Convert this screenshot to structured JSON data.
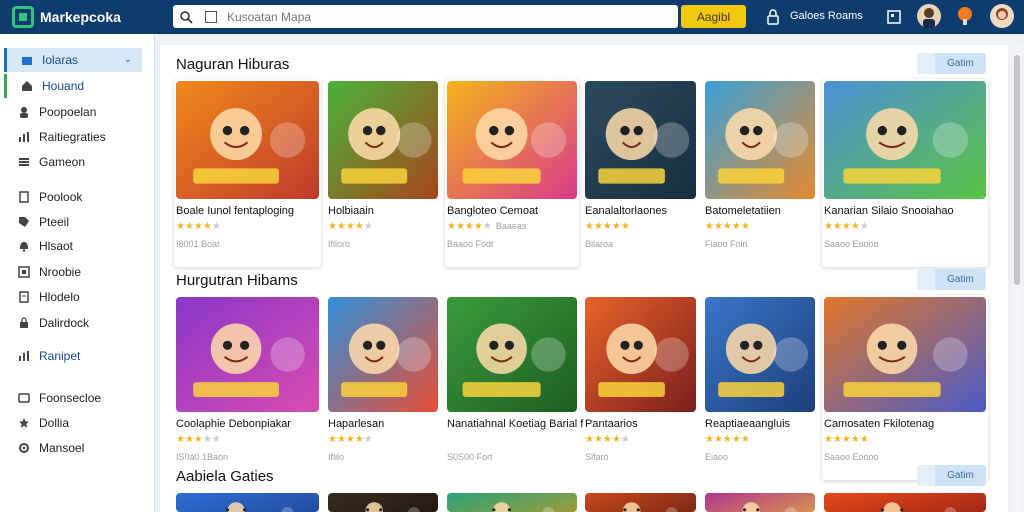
{
  "app": {
    "brand": "Markepcoka"
  },
  "search": {
    "placeholder": "Kusoatan Mapa",
    "button_label": "Aagibl"
  },
  "topbar": {
    "label": "Galoes Roams"
  },
  "sidebar": {
    "items": [
      {
        "label": "Iolaras",
        "icon": "folder-icon"
      },
      {
        "label": "Houand",
        "icon": "home-icon"
      },
      {
        "label": "Poopoelan",
        "icon": "user-icon"
      },
      {
        "label": "Raitiegraties",
        "icon": "chart-icon"
      },
      {
        "label": "Gameon",
        "icon": "list-icon"
      },
      {
        "label": "Poolook",
        "icon": "book-icon"
      },
      {
        "label": "Pteeil",
        "icon": "tag-icon"
      },
      {
        "label": "Hlsaot",
        "icon": "bell-icon"
      },
      {
        "label": "Nroobie",
        "icon": "grid-icon"
      },
      {
        "label": "Hlodelo",
        "icon": "doc-icon"
      },
      {
        "label": "Dalirdock",
        "icon": "lock-icon"
      },
      {
        "label": "Ranipet",
        "icon": "chart-icon"
      },
      {
        "label": "Foonsecloe",
        "icon": "card-icon"
      },
      {
        "label": "Dollia",
        "icon": "star-icon"
      },
      {
        "label": "Mansoel",
        "icon": "gear-icon"
      }
    ]
  },
  "sections": [
    {
      "title": "Naguran Hiburas",
      "see_all": "Gatim",
      "cards": [
        {
          "title": "Boale Iunol fentaploging",
          "rating": 3.5,
          "rating_note": "",
          "meta": "I8001 Boat",
          "colors": [
            "#f08a1c",
            "#c0392b"
          ]
        },
        {
          "title": "Holbiaain",
          "rating": 4,
          "rating_note": "",
          "meta": "Ifiloro",
          "colors": [
            "#49b33a",
            "#a8451c"
          ]
        },
        {
          "title": "Bangloteo Cemoat",
          "rating": 3.5,
          "rating_note": "Baaeas",
          "meta": "Baaoo Fodt",
          "colors": [
            "#f4b41a",
            "#d93a8b"
          ]
        },
        {
          "title": "Eanalaltorlaones",
          "rating": 5,
          "rating_note": "",
          "meta": "Bilaroa",
          "colors": [
            "#2d4a5e",
            "#17303f"
          ]
        },
        {
          "title": "Batomeletatiien",
          "rating": 5,
          "rating_note": "",
          "meta": "Fiaoo Foin",
          "colors": [
            "#3aa1d9",
            "#e68a2e"
          ]
        },
        {
          "title": "Kanarian Silaio Snooiahao",
          "rating": 3.5,
          "rating_note": "",
          "meta": "Saaoo Eoooo",
          "colors": [
            "#4e8fd6",
            "#5ac443"
          ]
        }
      ]
    },
    {
      "title": "Hurgutran Hibams",
      "see_all": "Gatim",
      "cards": [
        {
          "title": "Coolaphie Debonpiakar",
          "rating": 3,
          "rating_note": "",
          "meta": "IS0a0 1Baon",
          "colors": [
            "#8a37c9",
            "#d94bb0"
          ]
        },
        {
          "title": "Haparlesan",
          "rating": 4,
          "rating_note": "",
          "meta": "Iflilo",
          "colors": [
            "#2f8fd8",
            "#e74f36"
          ]
        },
        {
          "title": "Nanatiahnal Koetiag Barial f",
          "rating": 0,
          "rating_note": "",
          "meta": "S0S00 Fort",
          "colors": [
            "#3a9b3a",
            "#1d5e22"
          ]
        },
        {
          "title": "Pantaarios",
          "rating": 4,
          "rating_note": "",
          "meta": "Slfaro",
          "colors": [
            "#e8632a",
            "#7a1d1d"
          ]
        },
        {
          "title": "Reaptiaeaangluis",
          "rating": 5,
          "rating_note": "",
          "meta": "Eiaoo",
          "colors": [
            "#3b76c9",
            "#1c3f7a"
          ]
        },
        {
          "title": "Camosaten Fkilotenag",
          "rating": 4.5,
          "rating_note": "",
          "meta": "Saaoo Eoooo",
          "colors": [
            "#e0772b",
            "#4a5bc6"
          ]
        }
      ]
    },
    {
      "title": "Aabiela Gaties",
      "see_all": "Gatim",
      "cards": [
        {
          "colors": [
            "#2f6fd6",
            "#1d3f8a"
          ]
        },
        {
          "colors": [
            "#3a2a1f",
            "#1b1410"
          ]
        },
        {
          "colors": [
            "#2aa37a",
            "#c79a23"
          ]
        },
        {
          "colors": [
            "#c94a1d",
            "#5e1d12"
          ]
        },
        {
          "colors": [
            "#b0358e",
            "#e5b53a"
          ]
        },
        {
          "colors": [
            "#e64a1c",
            "#8a1c12"
          ]
        }
      ]
    }
  ]
}
